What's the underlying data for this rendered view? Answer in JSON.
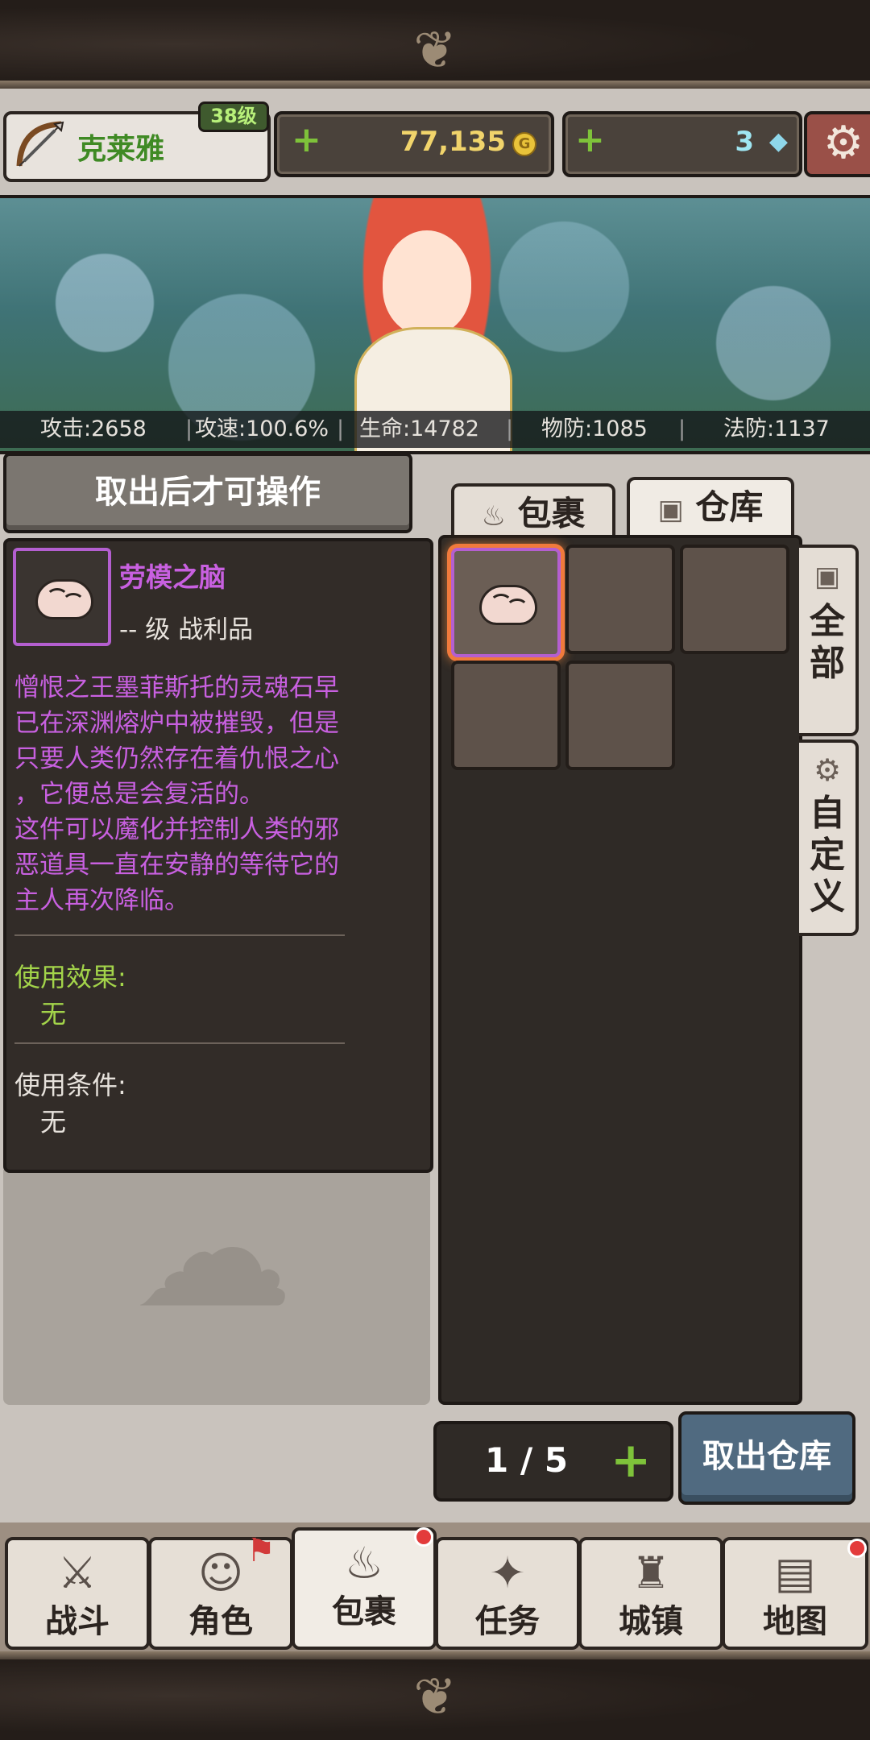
{
  "player": {
    "name": "克莱雅",
    "level": "38级",
    "gold": "77,135",
    "gems": "3"
  },
  "stats": {
    "attack": "攻击:2658",
    "attack_speed": "攻速:100.6%",
    "hp": "生命:14782",
    "phys_def": "物防:1085",
    "magic_def": "法防:1137"
  },
  "left_panel": {
    "header": "取出后才可操作",
    "item_name": "劳模之脑",
    "item_sub": "-- 级 战利品",
    "description": [
      "憎恨之王墨菲斯托的灵魂石早",
      "已在深渊熔炉中被摧毁，但是",
      "只要人类仍然存在着仇恨之心",
      "，它便总是会复活的。",
      "这件可以魔化并控制人类的邪",
      "恶道具一直在安静的等待它的",
      "主人再次降临。"
    ],
    "effect_label": "使用效果:",
    "effect_value": "无",
    "condition_label": "使用条件:",
    "condition_value": "无"
  },
  "tabs": {
    "bag": "包裹",
    "warehouse": "仓库"
  },
  "side_tabs": {
    "all": "全部",
    "custom": "自定义"
  },
  "pager": {
    "text": "1 / 5"
  },
  "withdraw_button": "取出仓库",
  "nav": [
    {
      "label": "战斗",
      "icon": "sword-icon"
    },
    {
      "label": "角色",
      "icon": "character-icon"
    },
    {
      "label": "包裹",
      "icon": "bag-icon"
    },
    {
      "label": "任务",
      "icon": "quest-icon"
    },
    {
      "label": "城镇",
      "icon": "town-icon"
    },
    {
      "label": "地图",
      "icon": "map-icon"
    }
  ],
  "colors": {
    "epic_purple": "#c860e0",
    "effect_green": "#a3d44a",
    "accent_blue": "#506a80",
    "alert_red": "#e33b3b"
  }
}
